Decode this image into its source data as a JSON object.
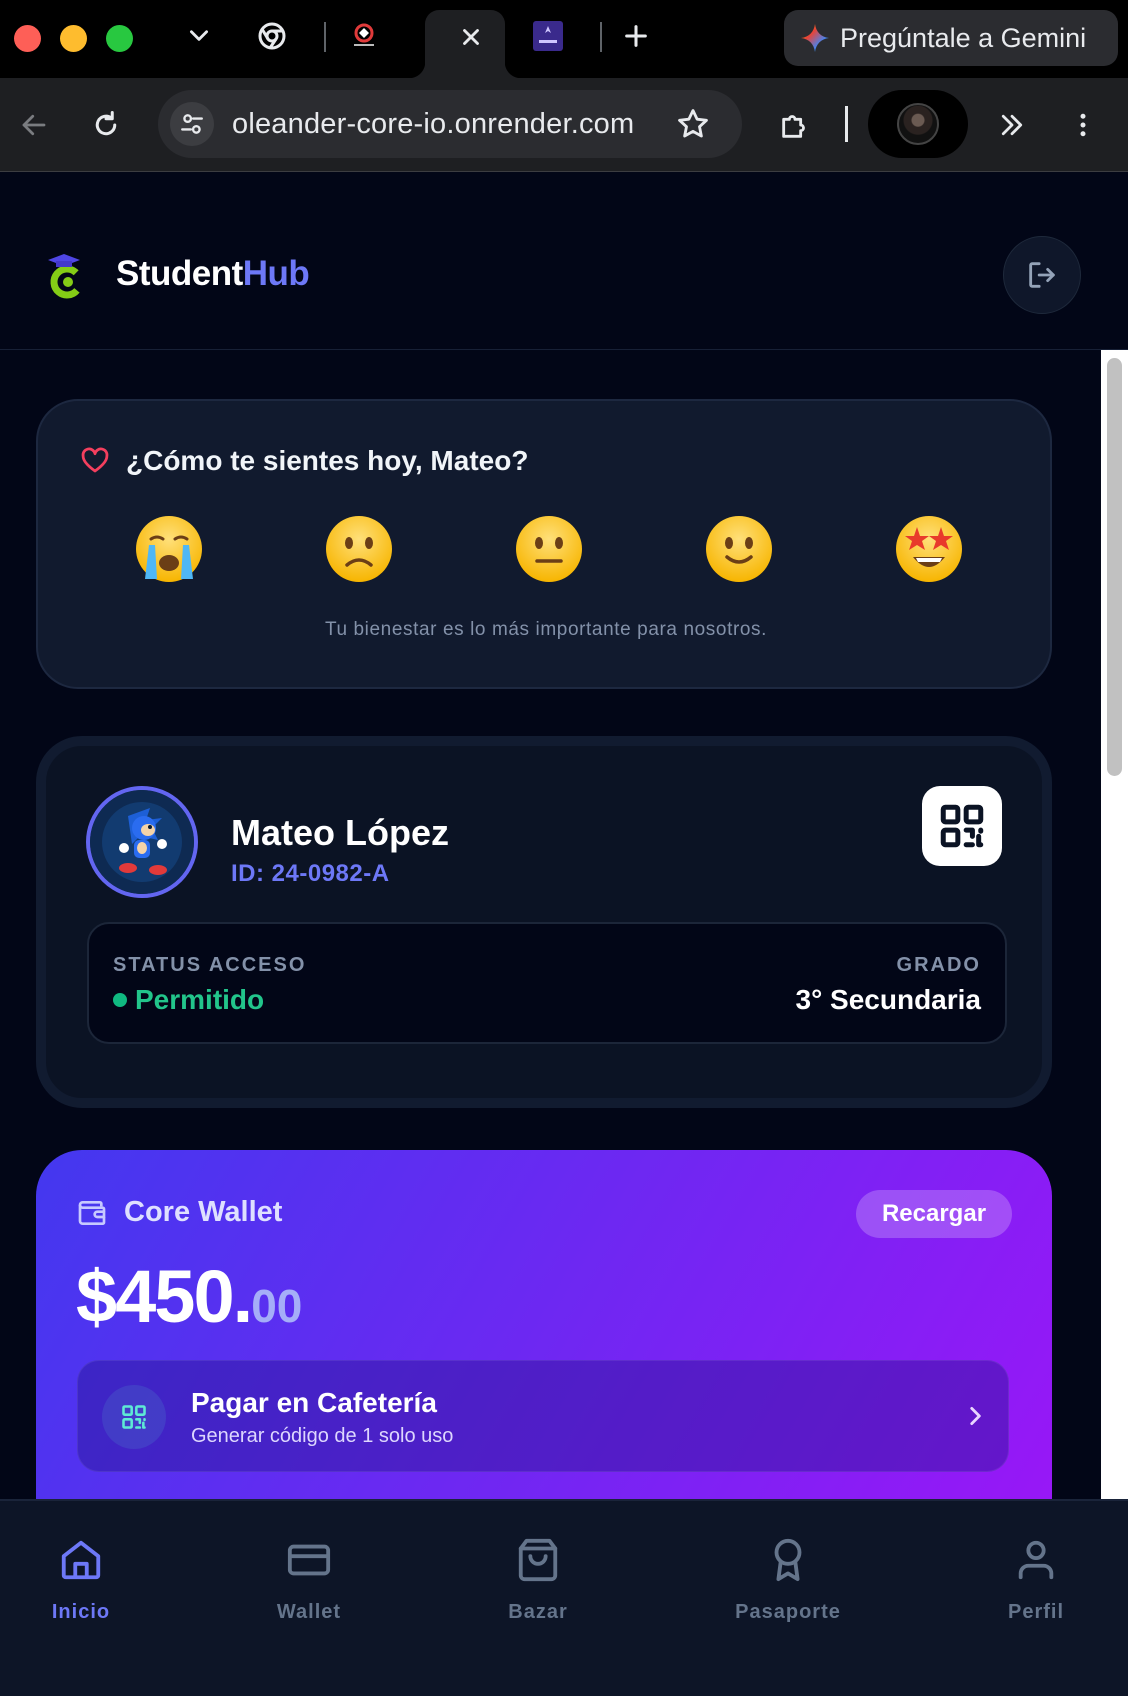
{
  "browser": {
    "address_bar": {
      "url": "oleander-core-io.onrender.com"
    },
    "gemini_button": {
      "label": "Pregúntale a Gemini"
    }
  },
  "app": {
    "brand": {
      "part1": "Student",
      "part2": "Hub",
      "accent_color": "#6d78f7"
    },
    "mood_card": {
      "title": "¿Cómo te sientes hoy, Mateo?",
      "subtitle": "Tu bienestar es lo más importante para nosotros.",
      "options": [
        "crying-face",
        "slightly-frowning-face",
        "neutral-face",
        "slightly-smiling-face",
        "star-struck-face"
      ]
    },
    "student": {
      "name": "Mateo López",
      "id": "ID: 24-0982-A",
      "status_label": "STATUS ACCESO",
      "status_value": "Permitido",
      "status_color": "#10b981",
      "grade_label": "GRADO",
      "grade_value": "3° Secundaria"
    },
    "wallet": {
      "title": "Core Wallet",
      "recharge_label": "Recargar",
      "balance_main": "$450.",
      "balance_cents": "00",
      "pay_title": "Pagar en Cafetería",
      "pay_subtitle": "Generar código de 1 solo uso"
    },
    "nav": {
      "items": [
        {
          "label": "Inicio",
          "icon": "home-icon",
          "active": true
        },
        {
          "label": "Wallet",
          "icon": "card-icon",
          "active": false
        },
        {
          "label": "Bazar",
          "icon": "bag-icon",
          "active": false
        },
        {
          "label": "Pasaporte",
          "icon": "award-icon",
          "active": false
        },
        {
          "label": "Perfil",
          "icon": "user-icon",
          "active": false
        }
      ]
    }
  }
}
